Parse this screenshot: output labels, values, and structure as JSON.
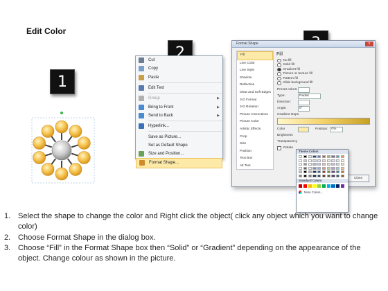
{
  "title": "Edit Color",
  "steps": {
    "one": "1",
    "two": "2",
    "three": "3"
  },
  "context_menu": {
    "items": [
      {
        "label": "Cut",
        "enabled": true,
        "submenu": false,
        "highlighted": false,
        "icon": "scissors-icon"
      },
      {
        "label": "Copy",
        "enabled": true,
        "submenu": false,
        "highlighted": false,
        "icon": "copy-icon"
      },
      {
        "label": "Paste",
        "enabled": true,
        "submenu": false,
        "highlighted": false,
        "icon": "paste-icon"
      },
      {
        "label": "Edit Text",
        "enabled": true,
        "submenu": false,
        "highlighted": false,
        "icon": "edit-text-icon"
      },
      {
        "label": "Group",
        "enabled": false,
        "submenu": true,
        "highlighted": false,
        "icon": "group-icon"
      },
      {
        "label": "Bring to Front",
        "enabled": true,
        "submenu": true,
        "highlighted": false,
        "icon": "bring-front-icon"
      },
      {
        "label": "Send to Back",
        "enabled": true,
        "submenu": true,
        "highlighted": false,
        "icon": "send-back-icon"
      },
      {
        "label": "Hyperlink...",
        "enabled": true,
        "submenu": false,
        "highlighted": false,
        "icon": "hyperlink-icon"
      },
      {
        "label": "Save as Picture...",
        "enabled": true,
        "submenu": false,
        "highlighted": false,
        "icon": ""
      },
      {
        "label": "Set as Default Shape",
        "enabled": true,
        "submenu": false,
        "highlighted": false,
        "icon": ""
      },
      {
        "label": "Size and Position...",
        "enabled": true,
        "submenu": false,
        "highlighted": false,
        "icon": "size-icon"
      },
      {
        "label": "Format Shape...",
        "enabled": true,
        "submenu": false,
        "highlighted": true,
        "icon": "format-icon"
      }
    ]
  },
  "dialog": {
    "title": "Format Shape",
    "close": "x",
    "sidebar": [
      "Fill",
      "Line Color",
      "Line Style",
      "Shadow",
      "Reflection",
      "Glow and Soft Edges",
      "3-D Format",
      "3-D Rotation",
      "Picture Corrections",
      "Picture Color",
      "Artistic Effects",
      "Crop",
      "Size",
      "Position",
      "Text Box",
      "Alt Text"
    ],
    "selected": "Fill",
    "pane_title": "Fill",
    "options": [
      "No fill",
      "Solid fill",
      "Gradient fill",
      "Picture or texture fill",
      "Pattern fill",
      "Slide background fill"
    ],
    "selected_option": "Gradient fill",
    "fields": [
      {
        "label": "Preset colors:",
        "value": ""
      },
      {
        "label": "Type:",
        "value": "Radial"
      },
      {
        "label": "Direction:",
        "value": ""
      },
      {
        "label": "Angle:",
        "value": "0°"
      }
    ],
    "gradient_stops_label": "Gradient stops",
    "color_label": "Color",
    "position_label": "Position:",
    "position_value": "0%",
    "brightness_label": "Brightness",
    "transparency_label": "Transparency",
    "rotate_label": "Rotate",
    "close_button": "Close"
  },
  "palette": {
    "theme_label": "Theme Colors",
    "standard_label": "Standard Colors",
    "more_label": "More Colors...",
    "theme_top": [
      "#ffffff",
      "#000000",
      "#eeece1",
      "#1f497d",
      "#4f81bd",
      "#c0504d",
      "#9bbb59",
      "#8064a2",
      "#4bacc6",
      "#f79646"
    ],
    "standard": [
      "#c00000",
      "#ff0000",
      "#ffc000",
      "#ffff00",
      "#92d050",
      "#00b050",
      "#00b0f0",
      "#0070c0",
      "#002060",
      "#7030a0"
    ]
  },
  "instructions": [
    {
      "num": "1.",
      "text": "Select the shape to change the color and Right click the object( click any object which you want to change color)"
    },
    {
      "num": "2.",
      "text": "Choose Format Shape in the dialog box."
    },
    {
      "num": "3.",
      "text": "Choose “Fill” in the Format Shape box then “Solid” or “Gradient” depending on the appearance of the object. Change colour as shown in the picture."
    }
  ]
}
